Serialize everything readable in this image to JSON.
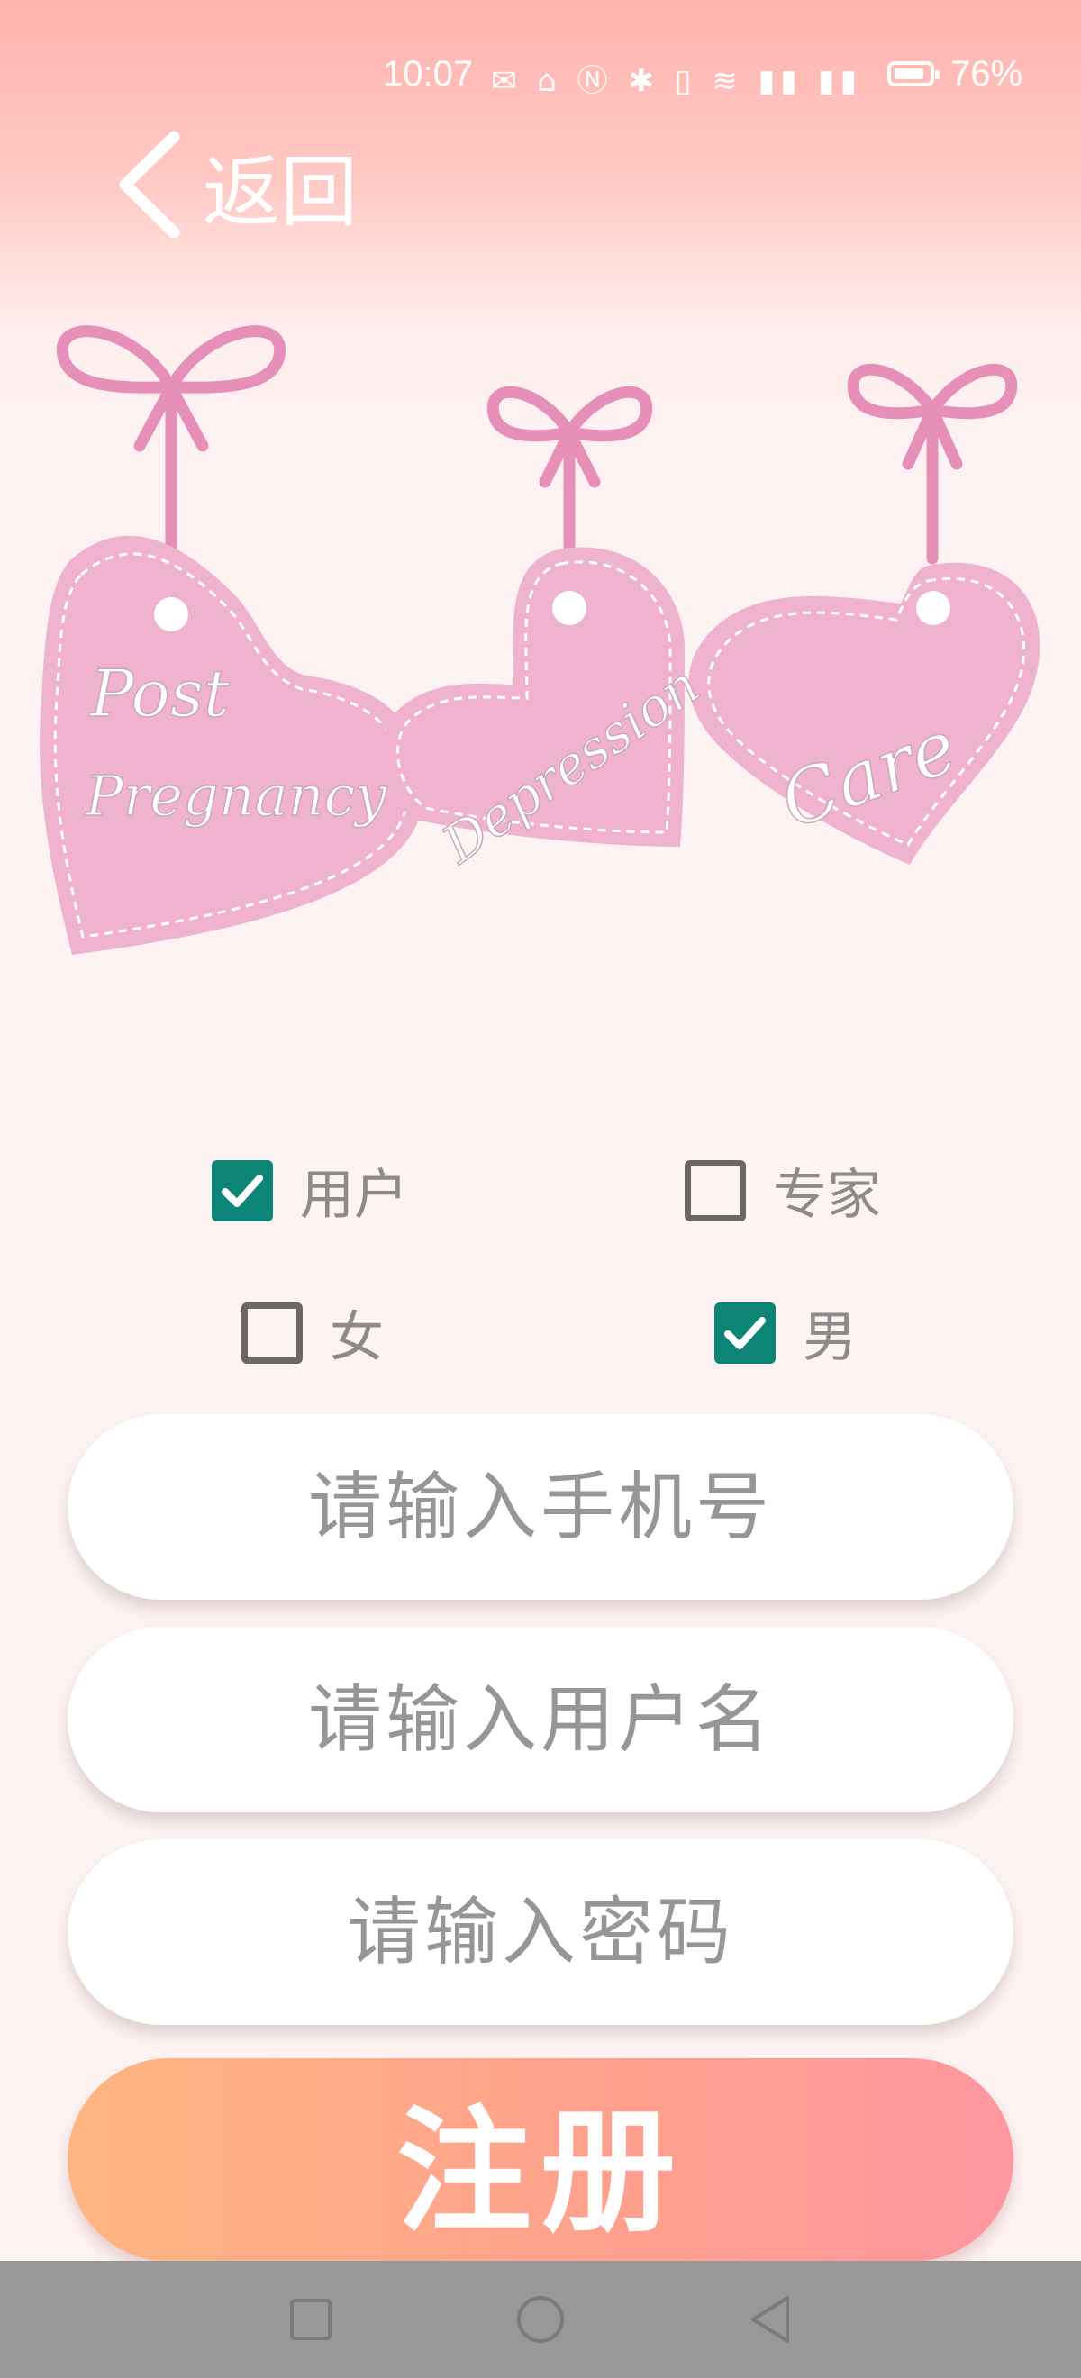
{
  "status_bar": {
    "time": "10:07",
    "icons": [
      "wechat-icon",
      "app-notification-icon",
      "nfc-icon",
      "bluetooth-icon",
      "vibrate-icon",
      "wifi-icon",
      "signal-4g-icon",
      "signal-4g-icon"
    ],
    "icon_glyphs": "✉ ⌂ Ⓝ ✱ ▯ ≋ ▮▮ ▮▮",
    "battery_percent": "76%"
  },
  "header": {
    "back_label": "返回"
  },
  "banner": {
    "words": [
      "Post",
      "Pregnancy",
      "Depression",
      "Care"
    ],
    "heart_color": "#f0b3cf",
    "ribbon_color": "#e68fb8"
  },
  "role_options": [
    {
      "label": "用户",
      "checked": true
    },
    {
      "label": "专家",
      "checked": false
    }
  ],
  "gender_options": [
    {
      "label": "女",
      "checked": false
    },
    {
      "label": "男",
      "checked": true
    }
  ],
  "form": {
    "phone_placeholder": "请输入手机号",
    "username_placeholder": "请输入用户名",
    "password_placeholder": "请输入密码",
    "register_label": "注册"
  },
  "colors": {
    "checkbox_checked": "#0c8577",
    "register_gradient_start": "#ffb582",
    "register_gradient_end": "#ff97a0"
  },
  "nav_bar": {
    "buttons": [
      "recents-icon",
      "home-icon",
      "back-icon"
    ]
  }
}
